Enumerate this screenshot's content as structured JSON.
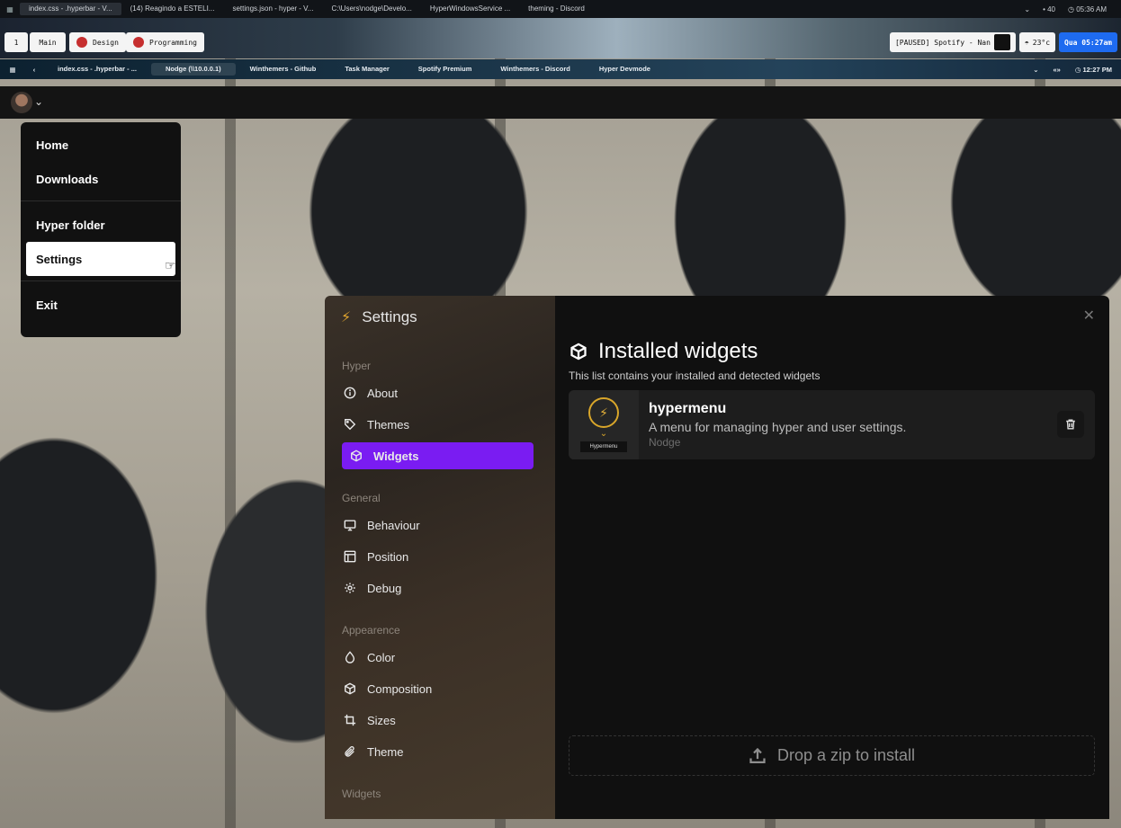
{
  "os_bar": {
    "tabs": [
      "index.css - .hyperbar - V...",
      "(14) Reagindo a ESTELI...",
      "settings.json - hyper - V...",
      "C:\\Users\\nodge\\Develo...",
      "HyperWindowsService ...",
      "theming - Discord"
    ],
    "volume": "• 40",
    "clock": "05:36 AM"
  },
  "workspace_bar": {
    "ws_number": "1",
    "ws_main": "Main",
    "ws_design": "Design",
    "ws_programming": "Programming",
    "spotify": "[PAUSED] Spotify - Nan",
    "weather": "23°c",
    "date": "Qua 05:27am"
  },
  "hyper_bar": {
    "tabs": [
      "index.css - .hyperbar - ...",
      "Nodge (\\\\10.0.0.1)",
      "Winthemers - Github",
      "Task Manager",
      "Spotify Premium",
      "Winthemers - Discord",
      "Hyper Devmode"
    ],
    "volume_icon": "«»",
    "clock": "12:27 PM"
  },
  "menu": {
    "home": "Home",
    "downloads": "Downloads",
    "hyper_folder": "Hyper folder",
    "settings": "Settings",
    "exit": "Exit"
  },
  "settings": {
    "title": "Settings",
    "groups": {
      "hyper": "Hyper",
      "general": "General",
      "appearence": "Appearence",
      "widgets": "Widgets"
    },
    "items": {
      "about": "About",
      "themes": "Themes",
      "widgets": "Widgets",
      "behaviour": "Behaviour",
      "position": "Position",
      "debug": "Debug",
      "color": "Color",
      "composition": "Composition",
      "sizes": "Sizes",
      "theme": "Theme"
    },
    "main_title": "Installed widgets",
    "main_subtitle": "This list contains your installed and detected widgets",
    "widget": {
      "name": "hypermenu",
      "description": "A menu for managing hyper and user settings.",
      "author": "Nodge",
      "thumb_label": "Hypermenu"
    },
    "dropzone": "Drop a zip to install"
  },
  "colors": {
    "accent": "#7a1cf2",
    "bolt": "#e1a62f"
  }
}
